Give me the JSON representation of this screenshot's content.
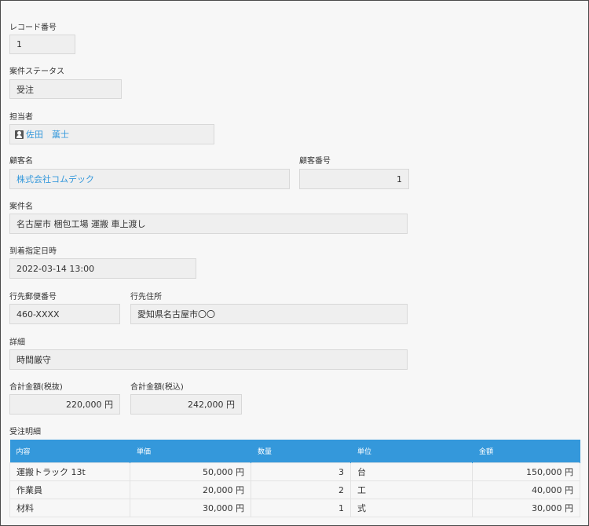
{
  "record_no": {
    "label": "レコード番号",
    "value": "1"
  },
  "status": {
    "label": "案件ステータス",
    "value": "受注"
  },
  "assignee": {
    "label": "担当者",
    "value": "佐田　薫士"
  },
  "customer": {
    "label": "顧客名",
    "value": "株式会社コムデック"
  },
  "customer_no": {
    "label": "顧客番号",
    "value": "1"
  },
  "project": {
    "label": "案件名",
    "value": "名古屋市 梱包工場 運搬 車上渡し"
  },
  "arrival": {
    "label": "到着指定日時",
    "value": "2022-03-14 13:00"
  },
  "postal": {
    "label": "行先郵便番号",
    "value": "460-XXXX"
  },
  "address": {
    "label": "行先住所",
    "value": "愛知県名古屋市〇〇"
  },
  "details": {
    "label": "詳細",
    "value": "時間厳守"
  },
  "total_ex": {
    "label": "合計金額(税抜)",
    "value": "220,000 円"
  },
  "total_in": {
    "label": "合計金額(税込)",
    "value": "242,000 円"
  },
  "order_table": {
    "label": "受注明細",
    "headers": [
      "内容",
      "単価",
      "数量",
      "単位",
      "金額"
    ],
    "rows": [
      [
        "運搬トラック 13t",
        "50,000 円",
        "3",
        "台",
        "150,000 円"
      ],
      [
        "作業員",
        "20,000 円",
        "2",
        "工",
        "40,000 円"
      ],
      [
        "材料",
        "30,000 円",
        "1",
        "式",
        "30,000 円"
      ]
    ]
  }
}
